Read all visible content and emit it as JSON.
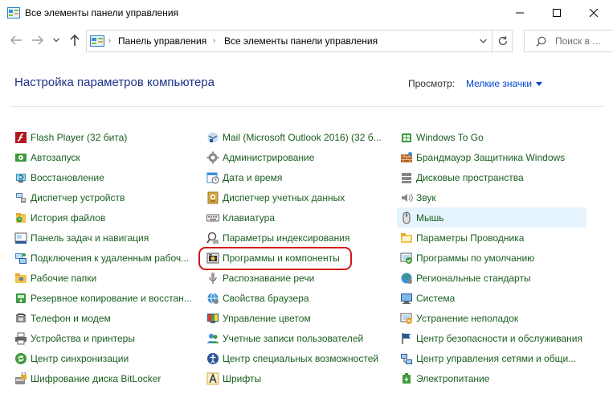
{
  "window": {
    "title": "Все элементы панели управления",
    "min_glyph": "—",
    "close_glyph": "✕"
  },
  "address": {
    "crumb1": "Панель управления",
    "crumb2": "Все элементы панели управления",
    "separator": "›"
  },
  "search": {
    "placeholder": "Поиск в ..."
  },
  "header": {
    "title": "Настройка параметров компьютера",
    "view_label": "Просмотр:",
    "view_value": "Мелкие значки"
  },
  "colors": {
    "link": "#1a5e1f",
    "title": "#1e3287",
    "highlight": "#d2141c",
    "hover": "#e5f3ff"
  },
  "columns": [
    {
      "items": [
        {
          "label": "Flash Player (32 бита)",
          "icon": "flash-icon"
        },
        {
          "label": "Автозапуск",
          "icon": "autoplay-icon"
        },
        {
          "label": "Восстановление",
          "icon": "recovery-icon"
        },
        {
          "label": "Диспетчер устройств",
          "icon": "device-manager-icon"
        },
        {
          "label": "История файлов",
          "icon": "file-history-icon"
        },
        {
          "label": "Панель задач и навигация",
          "icon": "taskbar-icon"
        },
        {
          "label": "Подключения к удаленным рабоч...",
          "icon": "remote-connections-icon"
        },
        {
          "label": "Рабочие папки",
          "icon": "work-folders-icon"
        },
        {
          "label": "Резервное копирование и восстан...",
          "icon": "backup-icon"
        },
        {
          "label": "Телефон и модем",
          "icon": "phone-modem-icon"
        },
        {
          "label": "Устройства и принтеры",
          "icon": "printer-icon"
        },
        {
          "label": "Центр синхронизации",
          "icon": "sync-center-icon"
        },
        {
          "label": "Шифрование диска BitLocker",
          "icon": "bitlocker-icon"
        }
      ]
    },
    {
      "items": [
        {
          "label": "Mail (Microsoft Outlook 2016) (32 б...",
          "icon": "mail-icon"
        },
        {
          "label": "Администрирование",
          "icon": "admin-tools-icon"
        },
        {
          "label": "Дата и время",
          "icon": "date-time-icon"
        },
        {
          "label": "Диспетчер учетных данных",
          "icon": "credential-manager-icon"
        },
        {
          "label": "Клавиатура",
          "icon": "keyboard-icon"
        },
        {
          "label": "Параметры индексирования",
          "icon": "indexing-icon"
        },
        {
          "label": "Программы и компоненты",
          "icon": "programs-features-icon"
        },
        {
          "label": "Распознавание речи",
          "icon": "speech-icon"
        },
        {
          "label": "Свойства браузера",
          "icon": "internet-options-icon"
        },
        {
          "label": "Управление цветом",
          "icon": "color-management-icon"
        },
        {
          "label": "Учетные записи пользователей",
          "icon": "user-accounts-icon"
        },
        {
          "label": "Центр специальных возможностей",
          "icon": "ease-of-access-icon"
        },
        {
          "label": "Шрифты",
          "icon": "fonts-icon"
        }
      ]
    },
    {
      "items": [
        {
          "label": "Windows To Go",
          "icon": "windows-to-go-icon"
        },
        {
          "label": "Брандмауэр Защитника Windows",
          "icon": "firewall-icon"
        },
        {
          "label": "Дисковые пространства",
          "icon": "storage-spaces-icon"
        },
        {
          "label": "Звук",
          "icon": "sound-icon"
        },
        {
          "label": "Мышь",
          "icon": "mouse-icon"
        },
        {
          "label": "Параметры Проводника",
          "icon": "explorer-options-icon"
        },
        {
          "label": "Программы по умолчанию",
          "icon": "default-programs-icon"
        },
        {
          "label": "Региональные стандарты",
          "icon": "region-icon"
        },
        {
          "label": "Система",
          "icon": "system-icon"
        },
        {
          "label": "Устранение неполадок",
          "icon": "troubleshooting-icon"
        },
        {
          "label": "Центр безопасности и обслуживания",
          "icon": "security-maintenance-icon"
        },
        {
          "label": "Центр управления сетями и общи...",
          "icon": "network-sharing-icon"
        },
        {
          "label": "Электропитание",
          "icon": "power-options-icon"
        }
      ]
    }
  ]
}
